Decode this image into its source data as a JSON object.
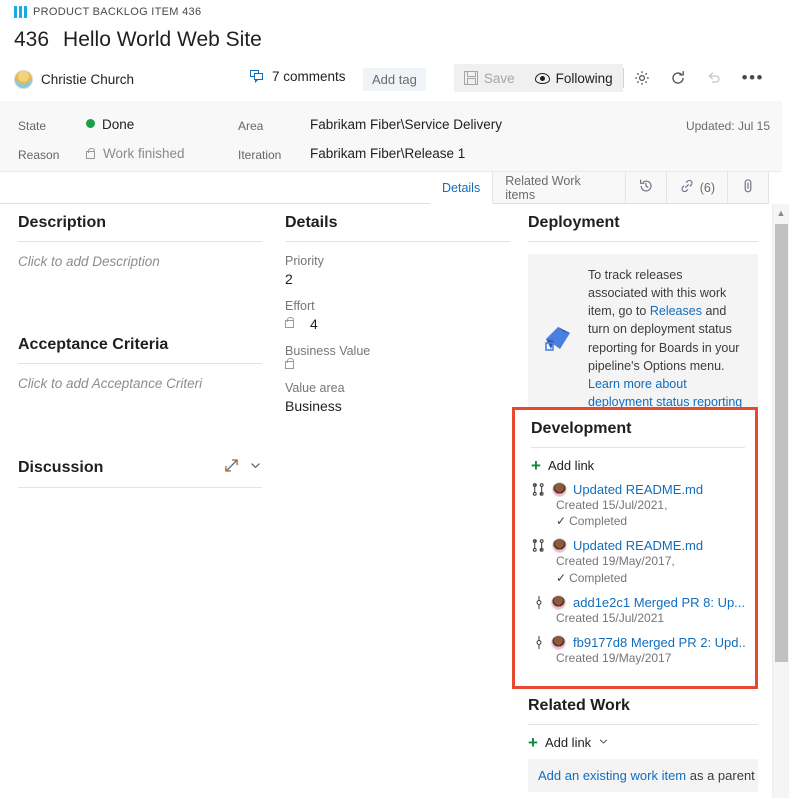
{
  "header": {
    "breadcrumb": "PRODUCT BACKLOG ITEM 436",
    "work_item_id": "436",
    "title": "Hello World Web Site",
    "assigned_to": "Christie Church",
    "comments_label": "7 comments",
    "add_tag_label": "Add tag",
    "accent_color": "#1aabe2"
  },
  "toolbar": {
    "save_label": "Save",
    "following_label": "Following",
    "settings_icon": "gear-icon",
    "refresh_icon": "refresh-icon",
    "undo_icon": "undo-icon",
    "more_icon": "more-actions-icon"
  },
  "fields": {
    "state_label": "State",
    "state_value": "Done",
    "state_color": "#1d9e48",
    "reason_label": "Reason",
    "reason_value": "Work finished",
    "area_label": "Area",
    "area_value": "Fabrikam Fiber\\Service Delivery",
    "iteration_label": "Iteration",
    "iteration_value": "Fabrikam Fiber\\Release 1",
    "updated": "Updated: Jul 15"
  },
  "tabs": [
    {
      "label": "Details",
      "active": true
    },
    {
      "label": "Related Work items",
      "active": false
    },
    {
      "label": "",
      "icon": "history-icon",
      "active": false
    },
    {
      "label": "(6)",
      "icon": "link-icon",
      "active": false
    },
    {
      "label": "",
      "icon": "attachment-icon",
      "active": false
    }
  ],
  "description": {
    "heading": "Description",
    "placeholder": "Click to add Description"
  },
  "acceptance": {
    "heading": "Acceptance Criteria",
    "placeholder": "Click to add Acceptance Criteri"
  },
  "discussion": {
    "heading": "Discussion",
    "expand_icon": "expand-icon",
    "collapse_icon": "chevron-down-icon"
  },
  "details": {
    "heading": "Details",
    "rows": [
      {
        "label": "Priority",
        "value": "2",
        "locked": false
      },
      {
        "label": "Effort",
        "value": "4",
        "locked": true
      },
      {
        "label": "Business Value",
        "value": "",
        "locked": true
      },
      {
        "label": "Value area",
        "value": "Business",
        "locked": false
      }
    ]
  },
  "deployment": {
    "heading": "Deployment",
    "icon": "azure-pipelines-icon",
    "text_parts": [
      {
        "text": "To track releases associated with this work item, go to ",
        "link": false
      },
      {
        "text": "Releases",
        "link": true
      },
      {
        "text": " and turn on deployment status reporting for Boards in your pipeline's Options menu. ",
        "link": false
      },
      {
        "text": "Learn more about deployment status reporting",
        "link": true
      }
    ]
  },
  "development": {
    "heading": "Development",
    "add_link_label": "Add link",
    "highlight_color": "#e8492e",
    "items": [
      {
        "icon": "pull-request-icon",
        "title": "Updated README.md",
        "created": "Created 15/Jul/2021,",
        "status": "Completed"
      },
      {
        "icon": "pull-request-icon",
        "title": "Updated README.md",
        "created": "Created 19/May/2017,",
        "status": "Completed"
      },
      {
        "icon": "commit-icon",
        "hash": "add1e2c1",
        "title": "Merged PR 8: Up...",
        "created": "Created 15/Jul/2021",
        "status": ""
      },
      {
        "icon": "commit-icon",
        "hash": "fb9177d8",
        "title": "Merged PR 2: Upd...",
        "created": "Created 19/May/2017",
        "status": ""
      }
    ]
  },
  "related_work": {
    "heading": "Related Work",
    "add_link_label": "Add link",
    "existing_link_text": "Add an existing work item",
    "existing_suffix": " as a parent"
  }
}
